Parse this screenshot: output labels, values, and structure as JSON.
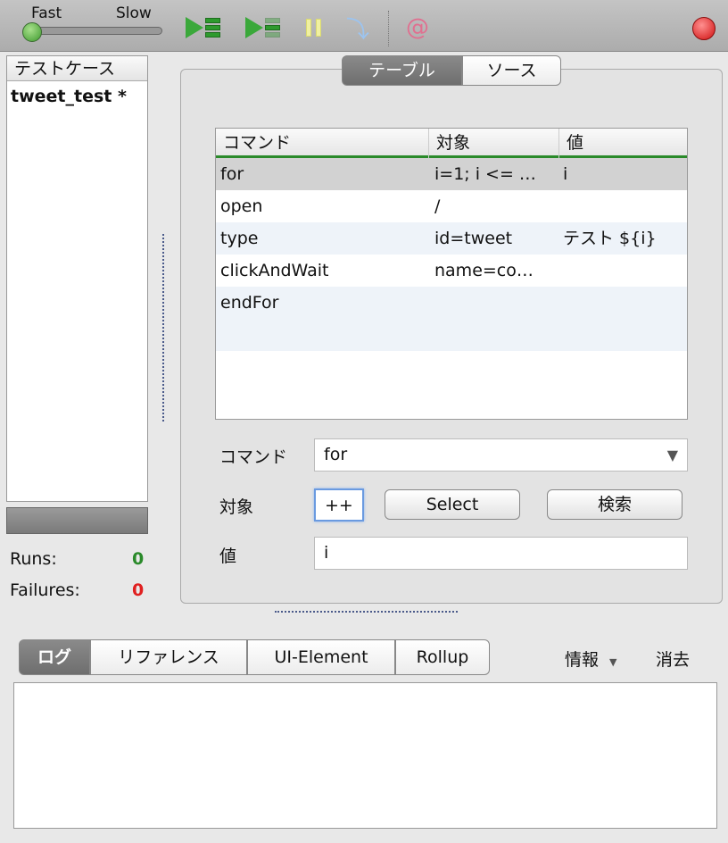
{
  "toolbar": {
    "fast": "Fast",
    "slow": "Slow",
    "speed": 0,
    "icons": [
      "play-all-icon",
      "play-current-icon",
      "pause-icon",
      "step-icon",
      "rollup-icon",
      "record-icon"
    ]
  },
  "testcases": {
    "header": "テストケース",
    "items": [
      {
        "label": "tweet_test *"
      }
    ]
  },
  "stats": {
    "runs_label": "Runs:",
    "runs": "0",
    "failures_label": "Failures:",
    "failures": "0",
    "runs_color": "#2a8a2a",
    "failures_color": "#e02020"
  },
  "tabs": {
    "table": "テーブル",
    "source": "ソース"
  },
  "table": {
    "columns": [
      "コマンド",
      "対象",
      "値"
    ],
    "rows": [
      {
        "command": "for",
        "target": "i=1; i <= …",
        "value": "i"
      },
      {
        "command": "open",
        "target": "/",
        "value": ""
      },
      {
        "command": "type",
        "target": "id=tweet",
        "value": "テスト ${i}"
      },
      {
        "command": "clickAndWait",
        "target": "name=co…",
        "value": ""
      },
      {
        "command": "endFor",
        "target": "",
        "value": ""
      }
    ]
  },
  "form": {
    "command_label": "コマンド",
    "command_value": "for",
    "target_label": "対象",
    "target_value": "++",
    "select_button": "Select",
    "find_button": "検索",
    "value_label": "値",
    "value_value": "i"
  },
  "bottom": {
    "tabs": [
      "ログ",
      "リファレンス",
      "UI-Element",
      "Rollup"
    ],
    "info": "情報",
    "clear": "消去"
  }
}
